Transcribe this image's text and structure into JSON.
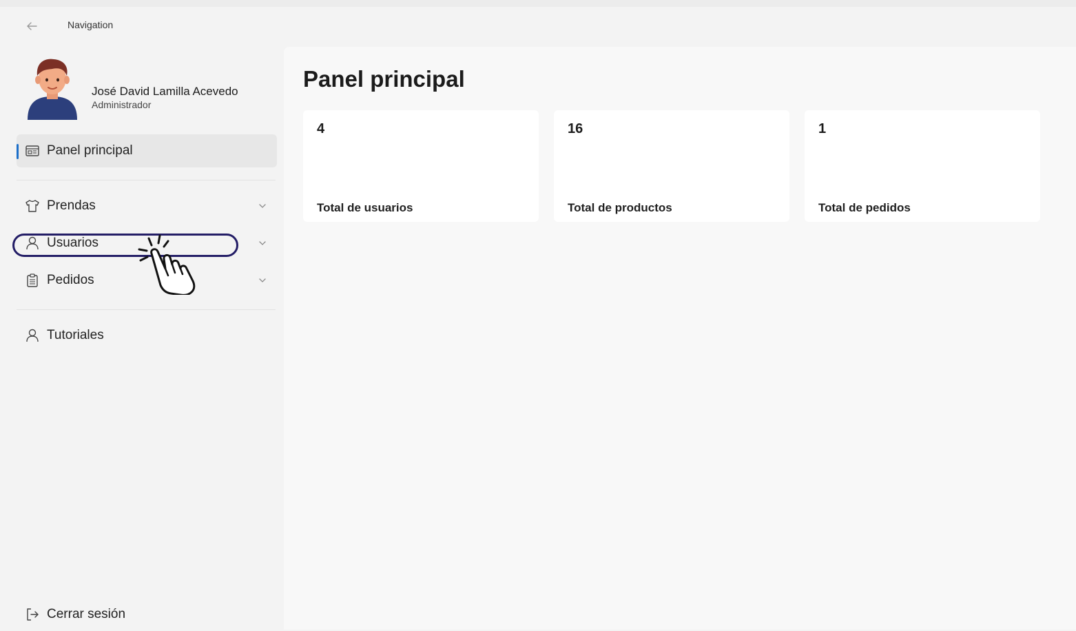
{
  "window": {
    "title": "Navigation"
  },
  "user": {
    "name": "José David Lamilla Acevedo",
    "role": "Administrador"
  },
  "nav": {
    "items": [
      {
        "label": "Panel principal",
        "icon": "dashboard-icon",
        "active": true
      },
      {
        "label": "Prendas",
        "icon": "shirt-icon",
        "expandable": true
      },
      {
        "label": "Usuarios",
        "icon": "person-icon",
        "expandable": true
      },
      {
        "label": "Pedidos",
        "icon": "clipboard-icon",
        "expandable": true
      },
      {
        "label": "Tutoriales",
        "icon": "person-icon"
      }
    ],
    "logout_label": "Cerrar sesión"
  },
  "main": {
    "title": "Panel principal",
    "stats": [
      {
        "value": "4",
        "label": "Total de usuarios"
      },
      {
        "value": "16",
        "label": "Total de productos"
      },
      {
        "value": "1",
        "label": "Total de pedidos"
      }
    ]
  },
  "colors": {
    "accent": "#1c6fc9",
    "highlight_ring": "#231d66",
    "content_bg": "#f8f8f8",
    "sidebar_bg": "#f3f3f3"
  }
}
